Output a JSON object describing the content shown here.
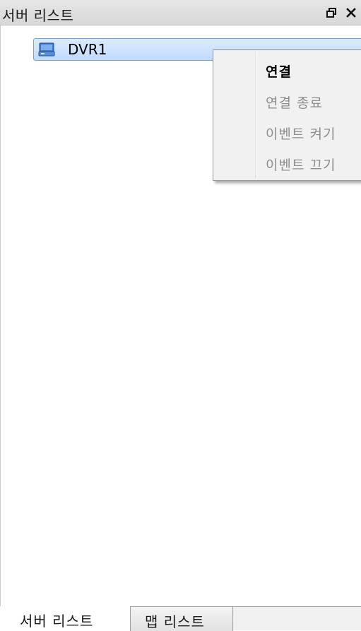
{
  "panel": {
    "title": "서버 리스트",
    "buttons": {
      "restore_icon": "restore-window-icon",
      "close_icon": "close-icon"
    }
  },
  "tree": {
    "items": [
      {
        "label": "DVR1",
        "icon": "dvr-server-icon",
        "selected": true
      }
    ]
  },
  "context_menu": {
    "items": [
      {
        "label": "연결",
        "enabled": true
      },
      {
        "label": "연결 종료",
        "enabled": false
      },
      {
        "label": "이벤트 켜기",
        "enabled": false
      },
      {
        "label": "이벤트 끄기",
        "enabled": false
      }
    ]
  },
  "tabs": [
    {
      "label": "서버 리스트",
      "active": true
    },
    {
      "label": "맵 리스트",
      "active": false
    }
  ],
  "colors": {
    "selection": "#c1dbfc",
    "selection_border": "#7da2ce",
    "disabled_text": "#8d8d8d"
  }
}
